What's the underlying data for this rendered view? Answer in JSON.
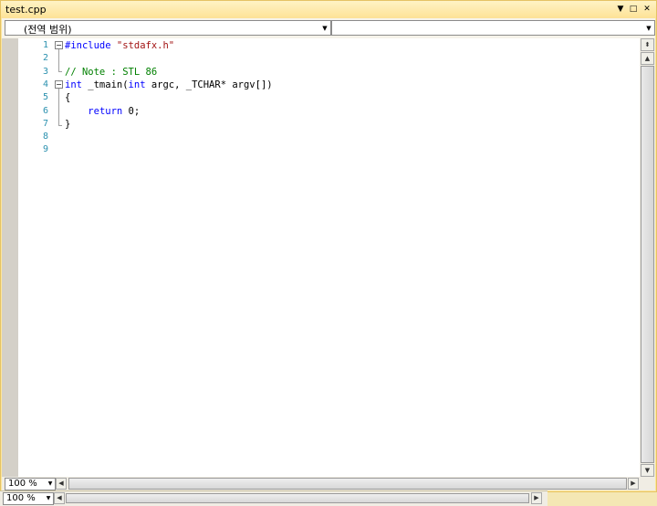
{
  "window": {
    "title": "test.cpp",
    "controls": {
      "dropdown": "▼",
      "maximize": "□",
      "close": "✕"
    }
  },
  "navbar": {
    "scope_combo": "(전역 범위)",
    "member_combo": ""
  },
  "editor": {
    "line_numbers": [
      "1",
      "2",
      "3",
      "4",
      "5",
      "6",
      "7",
      "8",
      "9"
    ],
    "lines": [
      [
        {
          "t": "#include ",
          "c": "kw"
        },
        {
          "t": "\"stdafx.h\"",
          "c": "str"
        }
      ],
      [],
      [
        {
          "t": "// Note : STL 86",
          "c": "cm"
        }
      ],
      [
        {
          "t": "int",
          "c": "kw"
        },
        {
          "t": " _tmain(",
          "c": ""
        },
        {
          "t": "int",
          "c": "kw"
        },
        {
          "t": " argc, _TCHAR* argv[])",
          "c": ""
        }
      ],
      [
        {
          "t": "{",
          "c": ""
        }
      ],
      [
        {
          "t": "    ",
          "c": ""
        },
        {
          "t": "return",
          "c": "kw"
        },
        {
          "t": " 0;",
          "c": ""
        }
      ],
      [
        {
          "t": "}",
          "c": ""
        }
      ],
      [],
      []
    ],
    "colors": {
      "keyword": "#0000ff",
      "string": "#a31515",
      "comment": "#008000",
      "line_number": "#2b91af"
    }
  },
  "statusbar": {
    "zoom": "100 %",
    "zoom_bottom": "100 %"
  },
  "icons": {
    "split": "split-view-icon",
    "up": "arrow-up-icon",
    "down": "arrow-down-icon",
    "left": "arrow-left-icon",
    "right": "arrow-right-icon"
  }
}
